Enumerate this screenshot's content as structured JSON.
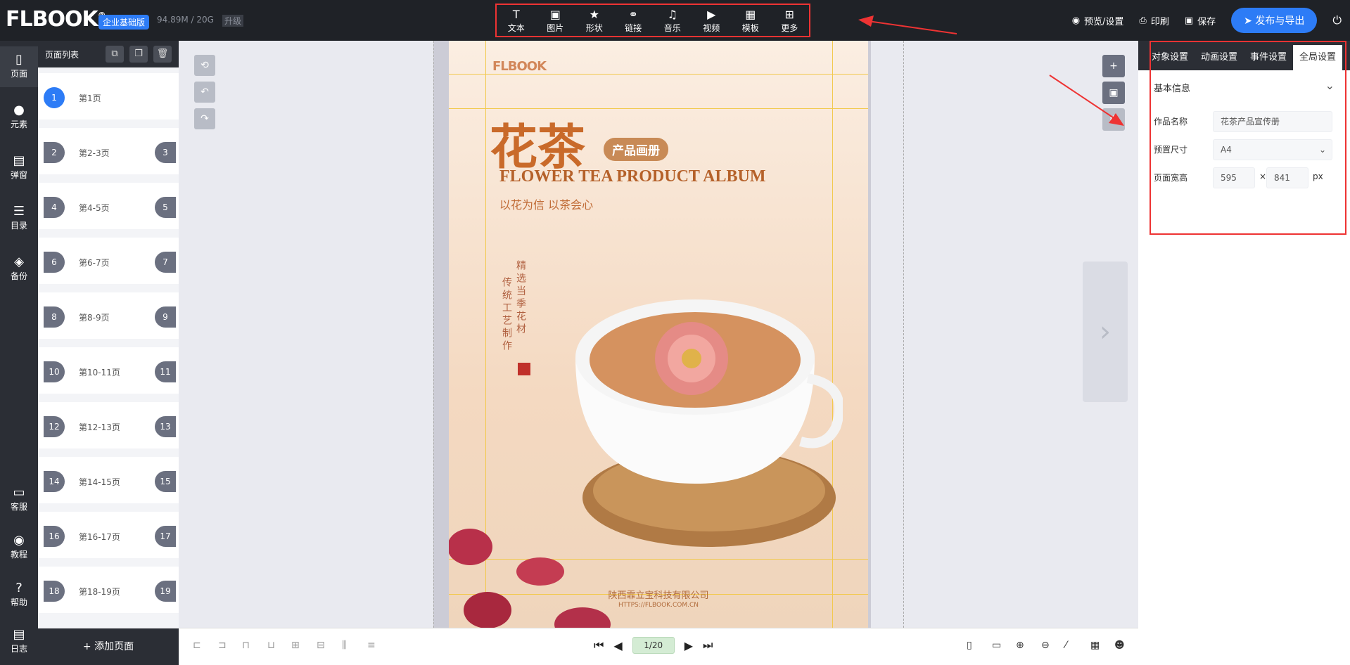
{
  "topbar": {
    "logo": "FLBOOK",
    "edition": "企业基础版",
    "storage": "94.89M / 20G",
    "upgrade": "升级",
    "tools": [
      {
        "icon": "text-icon",
        "glyph": "T",
        "label": "文本"
      },
      {
        "icon": "image-icon",
        "glyph": "▣",
        "label": "图片"
      },
      {
        "icon": "star-icon",
        "glyph": "★",
        "label": "形状"
      },
      {
        "icon": "link-icon",
        "glyph": "⚭",
        "label": "链接"
      },
      {
        "icon": "music-icon",
        "glyph": "♫",
        "label": "音乐"
      },
      {
        "icon": "video-icon",
        "glyph": "▶",
        "label": "视频"
      },
      {
        "icon": "template-icon",
        "glyph": "▦",
        "label": "模板"
      },
      {
        "icon": "more-icon",
        "glyph": "⊞",
        "label": "更多"
      }
    ],
    "preview": "预览/设置",
    "print": "印刷",
    "save": "保存",
    "publish": "发布与导出"
  },
  "rail": [
    {
      "icon": "page-icon",
      "glyph": "▯",
      "label": "页面"
    },
    {
      "icon": "element-icon",
      "glyph": "●",
      "label": "元素"
    },
    {
      "icon": "popup-icon",
      "glyph": "▤",
      "label": "弹窗"
    },
    {
      "icon": "catalog-icon",
      "glyph": "☰",
      "label": "目录"
    },
    {
      "icon": "backup-icon",
      "glyph": "◈",
      "label": "备份"
    },
    {
      "icon": "service-icon",
      "glyph": "▭",
      "label": "客服"
    },
    {
      "icon": "tutorial-icon",
      "glyph": "◉",
      "label": "教程"
    },
    {
      "icon": "help-icon",
      "glyph": "?",
      "label": "帮助"
    },
    {
      "icon": "log-icon",
      "glyph": "▤",
      "label": "日志"
    }
  ],
  "pagelist": {
    "title": "页面列表",
    "rows": [
      {
        "left": "1",
        "label": "第1页",
        "right": ""
      },
      {
        "left": "2",
        "label": "第2-3页",
        "right": "3"
      },
      {
        "left": "4",
        "label": "第4-5页",
        "right": "5"
      },
      {
        "left": "6",
        "label": "第6-7页",
        "right": "7"
      },
      {
        "left": "8",
        "label": "第8-9页",
        "right": "9"
      },
      {
        "left": "10",
        "label": "第10-11页",
        "right": "11"
      },
      {
        "left": "12",
        "label": "第12-13页",
        "right": "13"
      },
      {
        "left": "14",
        "label": "第14-15页",
        "right": "15"
      },
      {
        "left": "16",
        "label": "第16-17页",
        "right": "17"
      },
      {
        "left": "18",
        "label": "第18-19页",
        "right": "19"
      }
    ],
    "add": "+ 添加页面"
  },
  "poster": {
    "logo": "FLBOOK",
    "title_cn": "花茶",
    "pill": "产品画册",
    "title_en": "FLOWER TEA PRODUCT ALBUM",
    "slogan": "以花为信  以茶会心",
    "vert1": "精选当季花材",
    "vert2": "传统工艺制作",
    "company": "陕西霏立宝科技有限公司",
    "url": "HTTPS://FLBOOK.COM.CN"
  },
  "pager": {
    "current": "1/20"
  },
  "rpanel": {
    "tabs": [
      "对象设置",
      "动画设置",
      "事件设置",
      "全局设置"
    ],
    "section": "基本信息",
    "name_label": "作品名称",
    "name_value": "花茶产品宣传册",
    "size_label": "预置尺寸",
    "size_value": "A4",
    "wh_label": "页面宽高",
    "width": "595",
    "times": "×",
    "height": "841",
    "unit": "px"
  }
}
